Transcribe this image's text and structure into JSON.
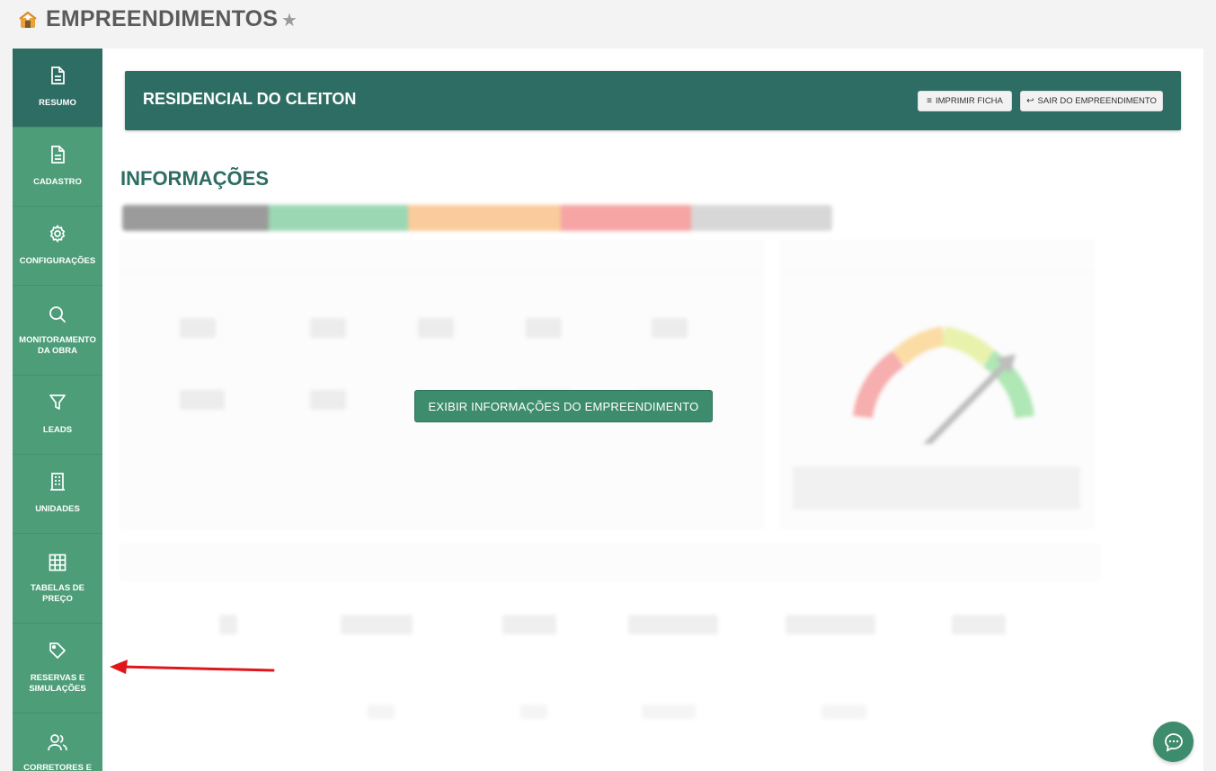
{
  "header": {
    "title": "EMPREENDIMENTOS",
    "logo_icon": "building-logo-icon",
    "favorite_icon": "star-icon"
  },
  "sidebar": {
    "items": [
      {
        "label": "RESUMO",
        "icon": "document-icon",
        "active": true
      },
      {
        "label": "CADASTRO",
        "icon": "document-icon",
        "active": false
      },
      {
        "label": "CONFIGURAÇÕES",
        "icon": "gear-icon",
        "active": false
      },
      {
        "label": "MONITORAMENTO DA OBRA",
        "icon": "search-icon",
        "active": false
      },
      {
        "label": "LEADS",
        "icon": "funnel-icon",
        "active": false
      },
      {
        "label": "UNIDADES",
        "icon": "building-icon",
        "active": false
      },
      {
        "label": "TABELAS DE PREÇO",
        "icon": "grid-icon",
        "active": false
      },
      {
        "label": "RESERVAS E SIMULAÇÕES",
        "icon": "tag-icon",
        "active": false
      },
      {
        "label": "CORRETORES E",
        "icon": "users-icon",
        "active": false
      }
    ]
  },
  "banner": {
    "title": "RESIDENCIAL DO CLEITON",
    "print_label": "IMPRIMIR FICHA",
    "exit_label": "SAIR DO EMPREENDIMENTO"
  },
  "main": {
    "section_title": "INFORMAÇÕES",
    "overlay_button": "EXIBIR INFORMAÇÕES DO EMPREENDIMENTO"
  },
  "colors": {
    "primary": "#2e6d63",
    "sidebar": "#4d9e78",
    "button": "#3e8c6e",
    "arrow": "#e0161b"
  }
}
